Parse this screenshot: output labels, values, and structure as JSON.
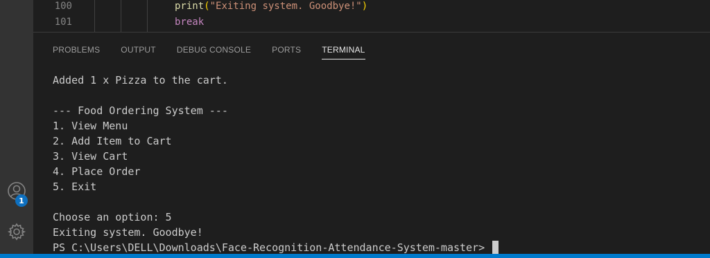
{
  "editor": {
    "lines": [
      {
        "number": "100",
        "fn": "print",
        "open": "(",
        "string": "\"Exiting system. Goodbye!\"",
        "close": ")"
      },
      {
        "number": "101",
        "keyword": "break"
      }
    ]
  },
  "panel": {
    "tabs": [
      {
        "label": "PROBLEMS"
      },
      {
        "label": "OUTPUT"
      },
      {
        "label": "DEBUG CONSOLE"
      },
      {
        "label": "PORTS"
      },
      {
        "label": "TERMINAL"
      }
    ],
    "active_tab": "TERMINAL"
  },
  "terminal": {
    "lines": [
      "Added 1 x Pizza to the cart.",
      "",
      "--- Food Ordering System ---",
      "1. View Menu",
      "2. Add Item to Cart",
      "3. View Cart",
      "4. Place Order",
      "5. Exit",
      "",
      "Choose an option: 5",
      "Exiting system. Goodbye!"
    ],
    "prompt": "PS C:\\Users\\DELL\\Downloads\\Face-Recognition-Attendance-System-master> "
  },
  "activity_bar": {
    "accounts_badge": "1",
    "icons": [
      "accounts-icon",
      "settings-gear-icon"
    ]
  },
  "colors": {
    "accent": "#007acc",
    "badge": "#0e70c0",
    "background": "#1e1e1e"
  }
}
